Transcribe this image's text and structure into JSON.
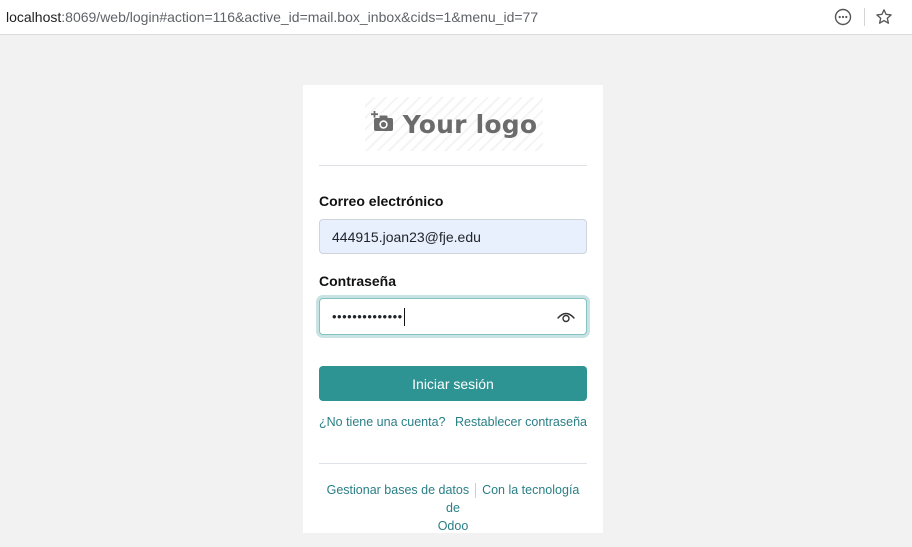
{
  "browser": {
    "url_host": "localhost",
    "url_rest": ":8069/web/login#action=116&active_id=mail.box_inbox&cids=1&menu_id=77",
    "icons": [
      "more-options-icon",
      "bookmark-star-icon"
    ]
  },
  "login": {
    "logo_text": "Your logo",
    "logo_icon": "add-photo-camera-icon",
    "email_label": "Correo electrónico",
    "email_value": "444915.joan23@fje.edu",
    "password_label": "Contraseña",
    "password_masked": "••••••••••••••",
    "password_icon": "eye-icon",
    "submit_label": "Iniciar sesión",
    "signup_link": "¿No tiene una cuenta?",
    "reset_link": "Restablecer contraseña"
  },
  "footer": {
    "manage_db": "Gestionar bases de datos",
    "powered_by": "Con la tecnología de",
    "brand": "Odoo"
  },
  "colors": {
    "primary": "#2e9393",
    "link": "#2a7f86",
    "email_autofill_bg": "#e8f0fe",
    "page_bg": "#f2f2f2"
  }
}
